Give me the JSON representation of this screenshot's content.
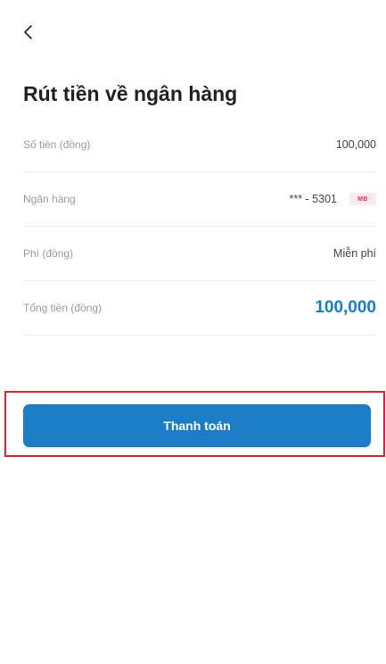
{
  "header": {
    "back_icon": "chevron-left-icon",
    "title": "Rút tiền về ngân hàng"
  },
  "summary": {
    "rows": [
      {
        "label": "Số tiền (đồng)",
        "value": "100,000"
      },
      {
        "label": "Ngân hàng",
        "value": "*** - 5301",
        "bank_logo": "MB"
      },
      {
        "label": "Phí (đồng)",
        "value": "Miễn phí"
      },
      {
        "label": "Tổng tiền (đồng)",
        "value": "100,000"
      }
    ]
  },
  "actions": {
    "pay_label": "Thanh toán"
  },
  "colors": {
    "accent": "#1b7dc6",
    "total_text": "#1a7cc4",
    "highlight_border": "#e0262b"
  }
}
